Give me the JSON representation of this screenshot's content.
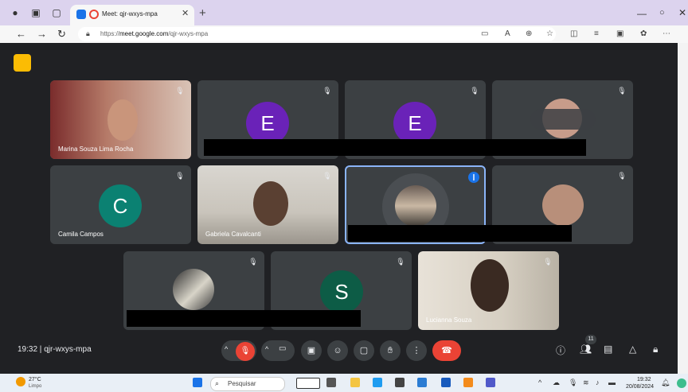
{
  "browser": {
    "tab_title": "Meet: qjr-wxys-mpa",
    "url_prefix": "https://",
    "url_host": "meet.google.com",
    "url_path": "/qjr-wxys-mpa"
  },
  "meeting": {
    "code": "qjr-wxys-mpa",
    "time": "19:32",
    "participant_count": "11"
  },
  "tiles": {
    "t1_name": "Marina Souza Lima Rocha",
    "t2_letter": "E",
    "t3_letter": "E",
    "t5_letter": "C",
    "t5_name": "Camila Campos",
    "t6_name": "Gabriela Cavalcanti",
    "t10_letter": "S",
    "t11_name": "Lucianna Souza"
  },
  "colors": {
    "avatar_purple": "#6a22b8",
    "avatar_teal": "#0b8172",
    "avatar_green": "#0d5c46",
    "end_call_red": "#ea4335",
    "active_border": "#8ab4f8"
  },
  "taskbar": {
    "temperature": "27°C",
    "weather": "Limpo",
    "search_placeholder": "Pesquisar",
    "time": "19:32",
    "date": "20/08/2024"
  }
}
